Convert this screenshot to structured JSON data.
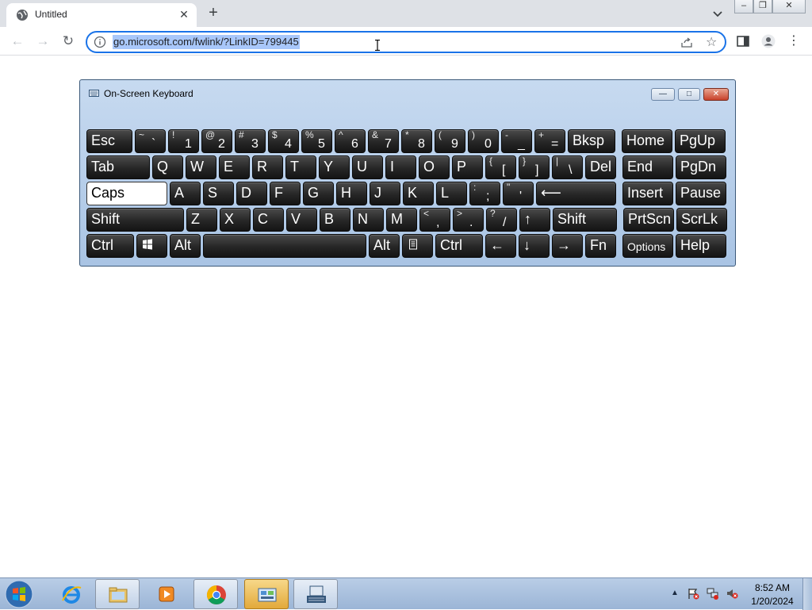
{
  "browser": {
    "tab_title": "Untitled",
    "tab_close": "✕",
    "new_tab": "+",
    "url": "go.microsoft.com/fwlink/?LinkID=799445",
    "back": "←",
    "forward": "→",
    "reload": "↻",
    "star": "☆",
    "menu": "⋮",
    "window_min": "–",
    "window_restore": "❐",
    "window_close": "✕"
  },
  "osk": {
    "title": "On-Screen Keyboard",
    "btn_min": "—",
    "btn_max": "□",
    "btn_close": "✕",
    "rows": [
      [
        {
          "main": "Esc"
        },
        {
          "sub": "~",
          "low": "`"
        },
        {
          "sub": "!",
          "low": "1"
        },
        {
          "sub": "@",
          "low": "2"
        },
        {
          "sub": "#",
          "low": "3"
        },
        {
          "sub": "$",
          "low": "4"
        },
        {
          "sub": "%",
          "low": "5"
        },
        {
          "sub": "^",
          "low": "6"
        },
        {
          "sub": "&",
          "low": "7"
        },
        {
          "sub": "*",
          "low": "8"
        },
        {
          "sub": "(",
          "low": "9"
        },
        {
          "sub": ")",
          "low": "0"
        },
        {
          "sub": "-",
          "low": "_"
        },
        {
          "sub": "+",
          "low": "="
        },
        {
          "main": "Bksp"
        },
        {
          "main": "Home"
        },
        {
          "main": "PgUp"
        }
      ],
      [
        {
          "main": "Tab"
        },
        {
          "main": "Q"
        },
        {
          "main": "W"
        },
        {
          "main": "E"
        },
        {
          "main": "R"
        },
        {
          "main": "T"
        },
        {
          "main": "Y"
        },
        {
          "main": "U"
        },
        {
          "main": "I"
        },
        {
          "main": "O"
        },
        {
          "main": "P"
        },
        {
          "sub": "{",
          "low": "["
        },
        {
          "sub": "}",
          "low": "]"
        },
        {
          "sub": "|",
          "low": "\\"
        },
        {
          "main": "Del"
        },
        {
          "main": "End"
        },
        {
          "main": "PgDn"
        }
      ],
      [
        {
          "main": "Caps"
        },
        {
          "main": "A"
        },
        {
          "main": "S"
        },
        {
          "main": "D"
        },
        {
          "main": "F"
        },
        {
          "main": "G"
        },
        {
          "main": "H"
        },
        {
          "main": "J"
        },
        {
          "main": "K"
        },
        {
          "main": "L"
        },
        {
          "sub": ":",
          "low": ";"
        },
        {
          "sub": "\"",
          "low": "'"
        },
        {
          "main": "⟵"
        },
        {
          "main": "Insert"
        },
        {
          "main": "Pause"
        }
      ],
      [
        {
          "main": "Shift"
        },
        {
          "main": "Z"
        },
        {
          "main": "X"
        },
        {
          "main": "C"
        },
        {
          "main": "V"
        },
        {
          "main": "B"
        },
        {
          "main": "N"
        },
        {
          "main": "M"
        },
        {
          "sub": "<",
          "low": ","
        },
        {
          "sub": ">",
          "low": "."
        },
        {
          "sub": "?",
          "low": "/"
        },
        {
          "main": "↑"
        },
        {
          "main": "Shift"
        },
        {
          "main": "PrtScn"
        },
        {
          "main": "ScrLk"
        }
      ],
      [
        {
          "main": "Ctrl"
        },
        {
          "main": "win-logo-icon",
          "icon": true
        },
        {
          "main": "Alt"
        },
        {
          "main": ""
        },
        {
          "main": "Alt"
        },
        {
          "main": "menu-key-icon",
          "icon": true
        },
        {
          "main": "Ctrl"
        },
        {
          "main": "←"
        },
        {
          "main": "↓"
        },
        {
          "main": "→"
        },
        {
          "main": "Fn"
        },
        {
          "main": "Options"
        },
        {
          "main": "Help"
        }
      ]
    ]
  },
  "taskbar": {
    "apps": [
      "internet-explorer-icon",
      "file-explorer-icon",
      "media-player-icon",
      "chrome-icon",
      "control-panel-icon",
      "on-screen-keyboard-icon"
    ],
    "time": "8:52 AM",
    "date": "1/20/2024"
  },
  "colors": {
    "omnibox_border": "#1a73e8",
    "url_selection": "#a8c7fa",
    "key_face": "#262626",
    "osk_frame": "#a9c4e4",
    "taskbar": "#9bb5d6"
  }
}
